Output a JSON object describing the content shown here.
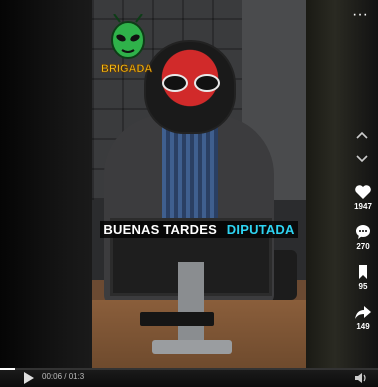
{
  "video": {
    "caption_part1": "BUENAS TARDES ",
    "caption_part2": "DIPUTADA",
    "logo_text": "BRIGADA"
  },
  "top": {
    "more_label": "···"
  },
  "nav": {
    "up_icon": "chevron-up-icon",
    "down_icon": "chevron-down-icon"
  },
  "actions": {
    "likes": "1947",
    "comments": "270",
    "saves": "95",
    "shares": "149"
  },
  "player": {
    "time": "00:06 / 01:3",
    "progress": 0.04
  },
  "colors": {
    "caption_accent": "#2ed4f2",
    "mask_red": "#d12a2a"
  }
}
